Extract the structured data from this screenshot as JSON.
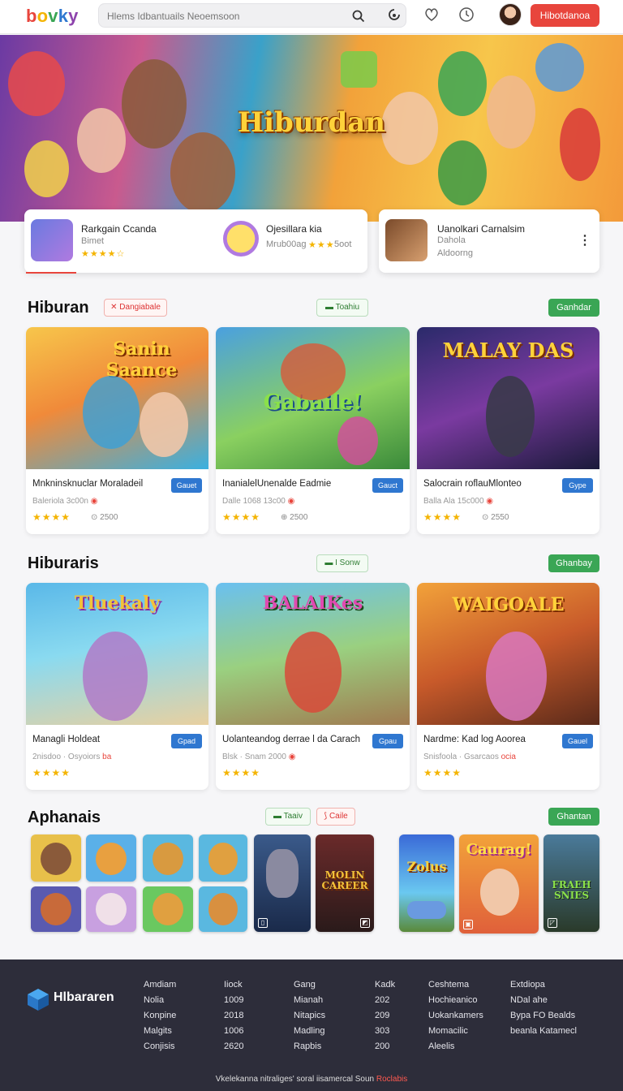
{
  "header": {
    "logo": [
      "b",
      "o",
      "v",
      "k",
      "y"
    ],
    "logo_colors": [
      "#e8453c",
      "#f4b400",
      "#3aa655",
      "#2f77d0",
      "#8e44ad"
    ],
    "search_placeholder": "Hlems Idbantuails Neoemsoon",
    "cta_label": "Hibotdanoa",
    "icons": [
      "search-icon",
      "microphone-icon",
      "heart-icon",
      "clock-icon"
    ]
  },
  "hero": {
    "title": "Hiburdan"
  },
  "featured": [
    {
      "title": "Rarkgain Ccanda",
      "sub": "Bimet",
      "stars": "★★★★☆"
    },
    {
      "title": "Ojesillara kia",
      "sub": "Mrub00ag",
      "stars": "★★★",
      "count": "5oot"
    },
    {
      "title": "Uanolkari Carnalsim",
      "sub": "Dahola",
      "sub2": "Aldoorng"
    }
  ],
  "section1": {
    "title": "Hiburan",
    "chip_red": "Dangiabale",
    "chip_green": "Toahiu",
    "button": "Ganhdar",
    "cards": [
      {
        "img_text": "Sanin Saance",
        "title": "Mnkninsknuclar Moraladeil",
        "tag": "Gauet",
        "meta": "Baleriola  3c00n",
        "stars": "★★★★",
        "count": "2500"
      },
      {
        "img_text": "Gabaile!",
        "title": "Inanialel​Unenalde Eadmie",
        "tag": "Gauct",
        "meta": "Dalle 1068  13c00",
        "stars": "★★★★",
        "count": "2500"
      },
      {
        "img_text": "MALAY DAS",
        "title": "Salocrain roflauMlonteo",
        "tag": "Gype",
        "meta": "Balla Ala  15c000",
        "stars": "★★★★",
        "count": "2550"
      }
    ]
  },
  "section2": {
    "title": "Hiburaris",
    "chip_green": "I Sonw",
    "button": "Ghanbay",
    "cards": [
      {
        "img_text": "Tluekaly",
        "title": "Managli Holdeat",
        "tag": "Gpad",
        "meta": "2nisdoo · Osyoiors",
        "meta_red": "ba",
        "stars": "★★★★"
      },
      {
        "img_text": "BALAIKes",
        "title": "Uolanteandog derrae l da Carach",
        "tag": "Gpau",
        "meta": "Blsk · Snam 2000",
        "stars": "★★★★"
      },
      {
        "img_text": "WAIGOALE",
        "title": "Nardme: Kad log Aoorea",
        "tag": "Gauel",
        "meta": "Snisfoola · Gsarcaos",
        "meta_red": "ocia",
        "stars": "★★★★"
      }
    ]
  },
  "section3": {
    "title": "Aphanais",
    "chip_green": "Taaiv",
    "chip_red": "Caile",
    "button": "Ghantan",
    "posters": [
      {
        "text": "MOLIN CAREER"
      },
      {
        "text": "Zolus"
      },
      {
        "text": "Caurag!"
      },
      {
        "text": "FRAEH SNIES"
      }
    ]
  },
  "footer": {
    "brand": "Hlbararen",
    "columns": [
      [
        "Amdiam",
        "Nolia",
        "Konpine",
        "Malgits",
        "Conjisis"
      ],
      [
        "Iiock",
        "1009",
        "2018",
        "1006",
        "2620"
      ],
      [
        "Gang",
        "Mianah",
        "Nitapics",
        "Madling",
        "Rapbis"
      ],
      [
        "Kadk",
        "202",
        "209",
        "303",
        "200"
      ],
      [
        "Ceshtema",
        "Hochieanico",
        "Uokankamers",
        "Momacilic",
        "Aleelis"
      ],
      [
        "Extdiopa",
        "NDal ahe",
        "Bypa FO Bealds",
        "beanla Katamecl"
      ]
    ],
    "bottom_text": "Vkelekanna nitraliges' soral iisamercal Soun",
    "bottom_red": "Roclabis"
  }
}
